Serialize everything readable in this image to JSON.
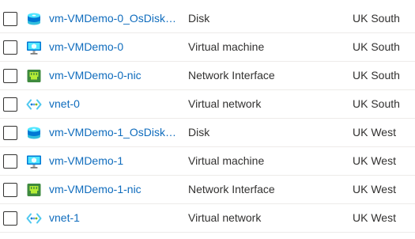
{
  "resources": [
    {
      "name": "vm-VMDemo-0_OsDisk_1_...",
      "type": "Disk",
      "location": "UK South",
      "icon": "disk-icon"
    },
    {
      "name": "vm-VMDemo-0",
      "type": "Virtual machine",
      "location": "UK South",
      "icon": "virtual-machine-icon"
    },
    {
      "name": "vm-VMDemo-0-nic",
      "type": "Network Interface",
      "location": "UK South",
      "icon": "network-interface-icon"
    },
    {
      "name": "vnet-0",
      "type": "Virtual network",
      "location": "UK South",
      "icon": "virtual-network-icon"
    },
    {
      "name": "vm-VMDemo-1_OsDisk_1_...",
      "type": "Disk",
      "location": "UK West",
      "icon": "disk-icon"
    },
    {
      "name": "vm-VMDemo-1",
      "type": "Virtual machine",
      "location": "UK West",
      "icon": "virtual-machine-icon"
    },
    {
      "name": "vm-VMDemo-1-nic",
      "type": "Network Interface",
      "location": "UK West",
      "icon": "network-interface-icon"
    },
    {
      "name": "vnet-1",
      "type": "Virtual network",
      "location": "UK West",
      "icon": "virtual-network-icon"
    }
  ],
  "colors": {
    "link": "#0f6cbd",
    "text": "#323130",
    "row_divider": "#edebe9"
  }
}
